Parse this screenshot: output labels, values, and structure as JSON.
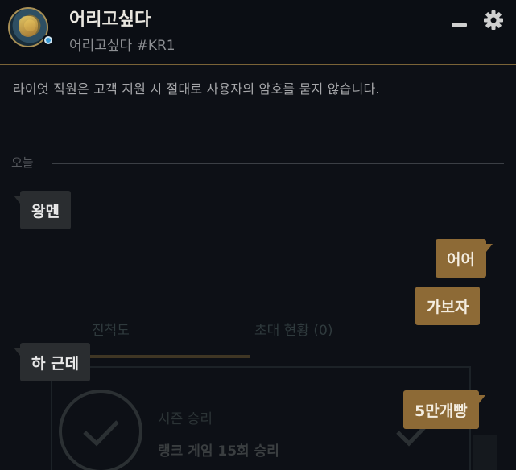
{
  "header": {
    "display_name": "어리고싶다",
    "riot_id": "어리고싶다 #KR1",
    "icons": {
      "avatar": "profile-avatar",
      "status": "online-status-icon",
      "minimize": "minimize-icon",
      "settings": "gear-icon"
    }
  },
  "notice": "라이엇 직원은 고객 지원 시 절대로 사용자의 암호를 묻지 않습니다.",
  "day_divider": "오늘",
  "messages": [
    {
      "side": "in",
      "text": "왕멘"
    },
    {
      "side": "out",
      "text": "어어"
    },
    {
      "side": "out",
      "text": "가보자"
    },
    {
      "side": "in",
      "text": "하 근데"
    },
    {
      "side": "out",
      "text": "5만개빵"
    }
  ],
  "background_overlay": {
    "tab_progress": "진척도",
    "tab_invites": "초대 현황 (0)",
    "mission_title": "시즌 승리",
    "mission_desc": "랭크 게임 15회 승리"
  },
  "colors": {
    "accent_gold": "#8d6a36",
    "header_border": "#7a6337",
    "incoming_bubble": "#2a2d30",
    "background": "#0d1016",
    "status_online": "#3a9bd6"
  }
}
